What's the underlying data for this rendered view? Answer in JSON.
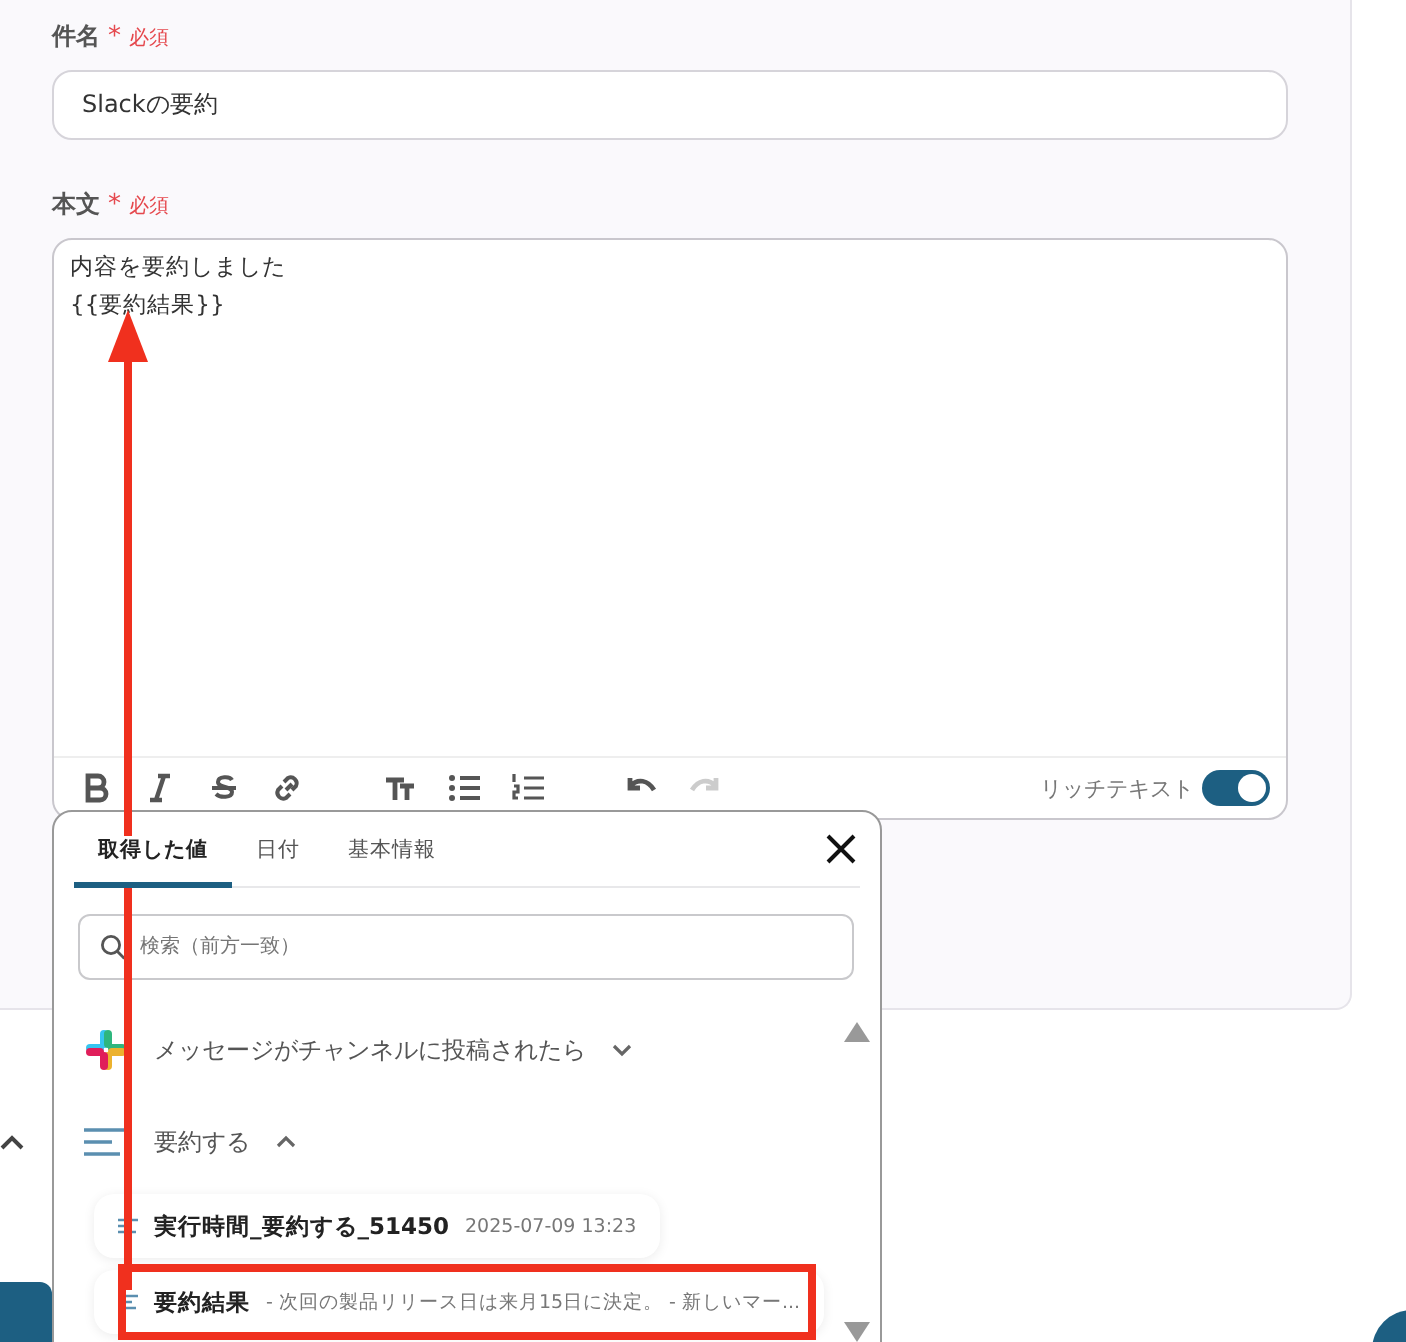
{
  "form": {
    "fields": [
      {
        "kind": "text",
        "label": "件名",
        "required_mark": "*",
        "required_text": "必須",
        "lines": [
          "Slackの要約"
        ]
      },
      {
        "kind": "richtext",
        "label": "本文",
        "required_mark": "*",
        "required_text": "必須",
        "lines": [
          "内容を要約しました",
          "{{要約結果}}"
        ]
      }
    ],
    "toolbar": [
      {
        "kind": "bold",
        "disabled": false
      },
      {
        "kind": "italic",
        "disabled": false
      },
      {
        "kind": "strike",
        "disabled": false
      },
      {
        "kind": "link",
        "disabled": false
      },
      {
        "kind": "textsize",
        "disabled": false
      },
      {
        "kind": "bullets",
        "disabled": false
      },
      {
        "kind": "numbered",
        "disabled": false
      },
      {
        "kind": "undo",
        "disabled": false
      },
      {
        "kind": "redo",
        "disabled": true
      }
    ],
    "rich_text": {
      "label": "リッチテキスト",
      "on": true
    }
  },
  "picker": {
    "tabs": [
      {
        "label": "取得した値",
        "selected": true
      },
      {
        "label": "日付",
        "selected": false
      },
      {
        "label": "基本情報",
        "selected": false
      }
    ],
    "search": {
      "placeholder": "検索（前方一致）"
    },
    "groups": [
      {
        "kind": "slack",
        "title": "メッセージがチャンネルに投稿されたら",
        "expanded": false
      },
      {
        "kind": "summary",
        "title": "要約する",
        "expanded": true,
        "items": [
          {
            "name": "実行時間_要約する_51450",
            "value": "2025-07-09 13:23",
            "annotated": false
          },
          {
            "name": "要約結果",
            "value": "- 次回の製品リリース日は来月15日に決定。 - 新しいマー...",
            "annotated": true
          }
        ]
      }
    ]
  }
}
